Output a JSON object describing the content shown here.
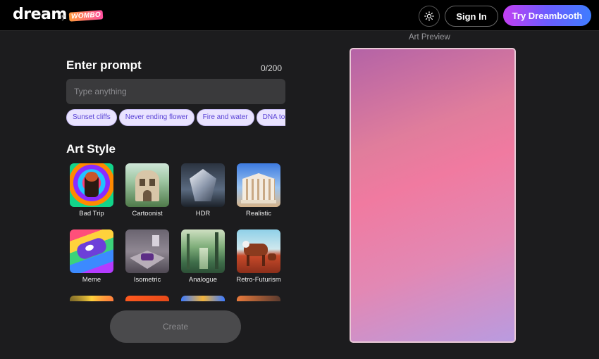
{
  "header": {
    "logo_text": "dream",
    "by_text": "by",
    "brand_text": "WOMBO",
    "theme_toggle_icon": "sun-icon",
    "signin_label": "Sign In",
    "dreambooth_label": "Try Dreambooth"
  },
  "prompt": {
    "title": "Enter prompt",
    "counter": "0/200",
    "value": "",
    "placeholder": "Type anything",
    "suggestions": [
      "Sunset cliffs",
      "Never ending flower",
      "Fire and water",
      "DNA tornado"
    ]
  },
  "art_style": {
    "title": "Art Style",
    "styles": [
      {
        "label": "Bad Trip"
      },
      {
        "label": "Cartoonist"
      },
      {
        "label": "HDR"
      },
      {
        "label": "Realistic"
      },
      {
        "label": "Meme"
      },
      {
        "label": "Isometric"
      },
      {
        "label": "Analogue"
      },
      {
        "label": "Retro-Futurism"
      }
    ]
  },
  "create_label": "Create",
  "preview": {
    "label": "Art Preview"
  },
  "colors": {
    "accent_gradient_start": "#c43ff2",
    "accent_gradient_end": "#3f7dff",
    "chip_text": "#5a43d6"
  }
}
